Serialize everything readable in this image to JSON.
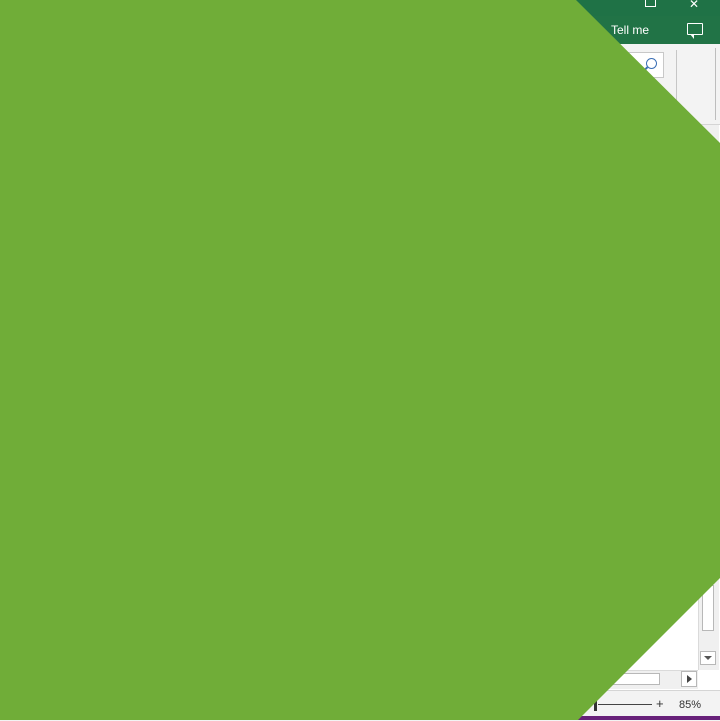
{
  "ribbon": {
    "tell_me": "Tell me"
  },
  "statusbar": {
    "zoom_level": "85%",
    "zoom_plus": "+"
  },
  "icons": {
    "restore": "restore-icon",
    "close": "close-icon",
    "comment": "comment-icon",
    "search": "search-icon"
  },
  "colors": {
    "excel_green": "#217346",
    "overlay_green": "#70ad38",
    "accent_purple": "#68217a"
  },
  "window_controls": {
    "close_glyph": "✕"
  }
}
